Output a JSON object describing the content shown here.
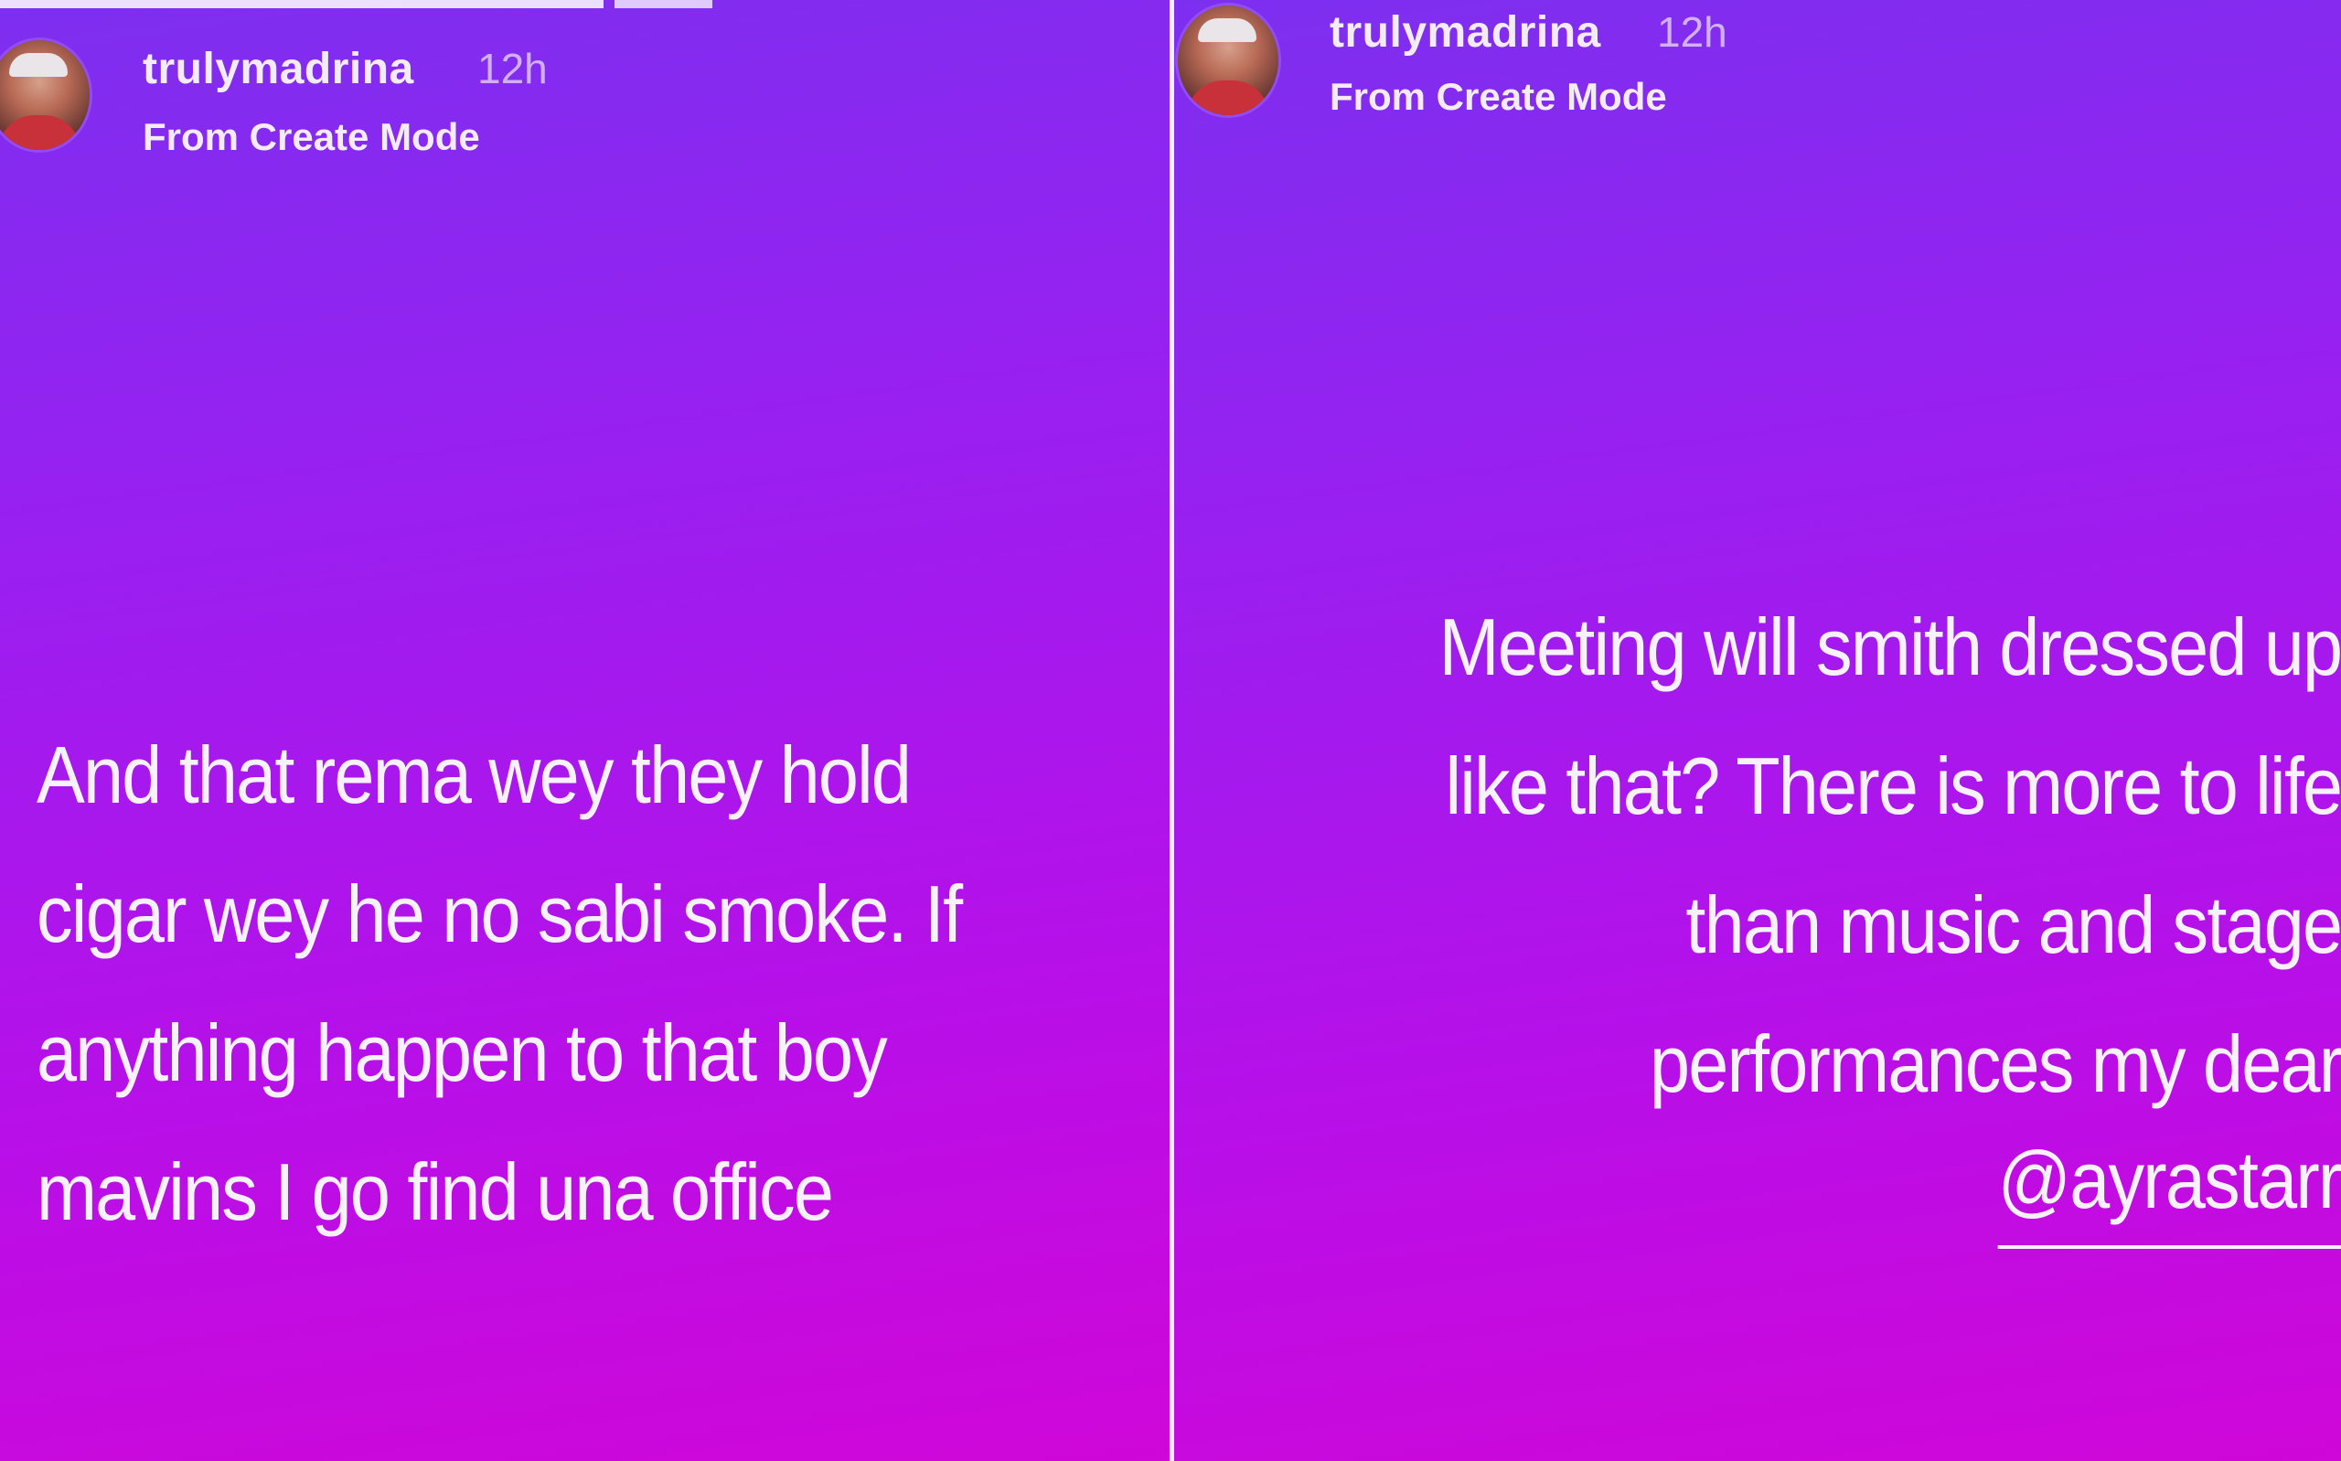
{
  "stories": {
    "left": {
      "username": "trulymadrina",
      "time": "12h",
      "subtitle": "From Create Mode",
      "text_lines": [
        "And that rema wey they hold",
        "cigar wey he no sabi smoke. If",
        "anything happen to that boy",
        "mavins I go find una office"
      ]
    },
    "right": {
      "username": "trulymadrina",
      "time": "12h",
      "subtitle": "From Create Mode",
      "text_lines": [
        "Meeting will smith dressed up",
        "like that? There is more to life",
        "than music and stage",
        "performances my dear"
      ],
      "mention": "@ayrastarr"
    }
  },
  "colors": {
    "gradient_top": "#7d2ff0",
    "gradient_bottom": "#cf07d8",
    "text": "#f7f1fa"
  }
}
